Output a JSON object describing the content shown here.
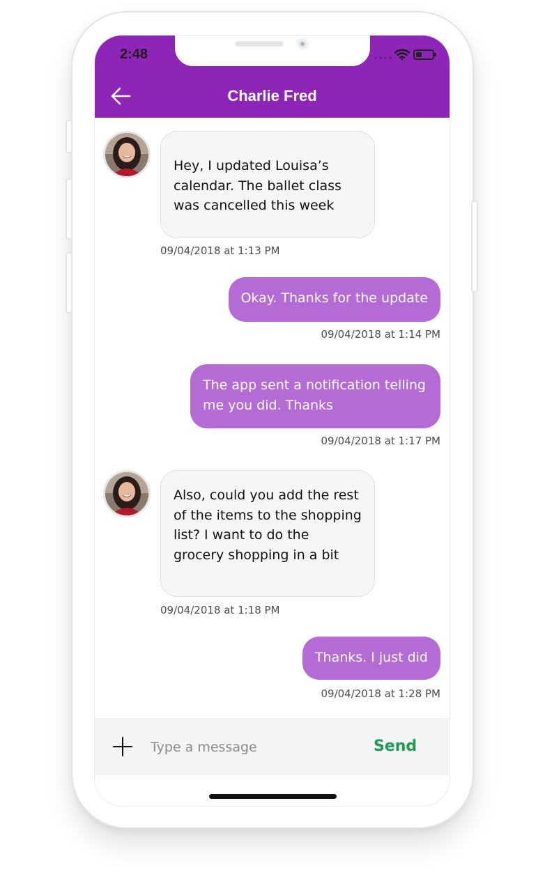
{
  "status_bar": {
    "time": "2:48"
  },
  "header": {
    "title": "Charlie Fred",
    "back_icon": "arrow-left-icon"
  },
  "colors": {
    "header": "#8e24b8",
    "outgoing_bubble": "#b56bd6",
    "incoming_bubble": "#f5f6f8",
    "send": "#1d9b57"
  },
  "messages": [
    {
      "direction": "incoming",
      "text": "Hey, I updated Louisa’s calendar. The ballet class was cancelled this week",
      "timestamp": "09/04/2018 at 1:13 PM"
    },
    {
      "direction": "outgoing",
      "text": "Okay. Thanks for the update",
      "timestamp": "09/04/2018 at 1:14 PM"
    },
    {
      "direction": "outgoing",
      "text": "The app sent a notification telling me you did. Thanks",
      "timestamp": "09/04/2018 at 1:17 PM"
    },
    {
      "direction": "incoming",
      "text": "Also, could you add the rest of the items to the shopping list? I want to do the grocery shopping in a bit",
      "timestamp": "09/04/2018 at 1:18 PM"
    },
    {
      "direction": "outgoing",
      "text": "Thanks. I just did",
      "timestamp": "09/04/2018 at 1:28 PM"
    }
  ],
  "composer": {
    "placeholder": "Type a message",
    "send_label": "Send",
    "add_icon": "plus-icon"
  }
}
